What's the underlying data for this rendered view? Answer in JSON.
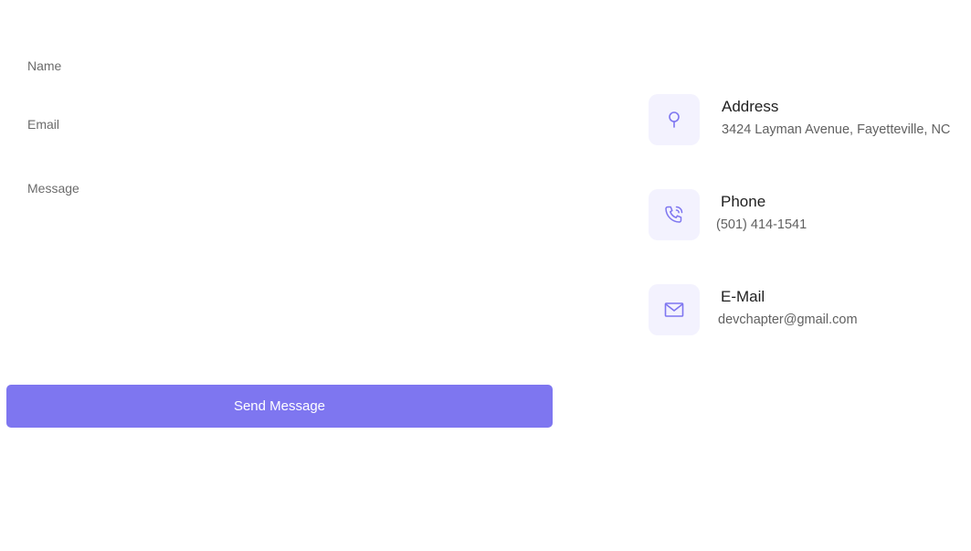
{
  "form": {
    "name_placeholder": "Name",
    "email_placeholder": "Email",
    "message_placeholder": "Message",
    "submit_label": "Send Message"
  },
  "contact": {
    "address": {
      "title": "Address",
      "value": "3424 Layman Avenue, Fayetteville, NC",
      "icon": "map-pin-icon"
    },
    "phone": {
      "title": "Phone",
      "value": "(501) 414-1541",
      "icon": "phone-icon"
    },
    "email": {
      "title": "E-Mail",
      "value": "devchapter@gmail.com",
      "icon": "envelope-icon"
    }
  },
  "colors": {
    "accent": "#7e76f0",
    "icon_bg": "#f3f2fe",
    "icon_stroke": "#7e76f0"
  }
}
